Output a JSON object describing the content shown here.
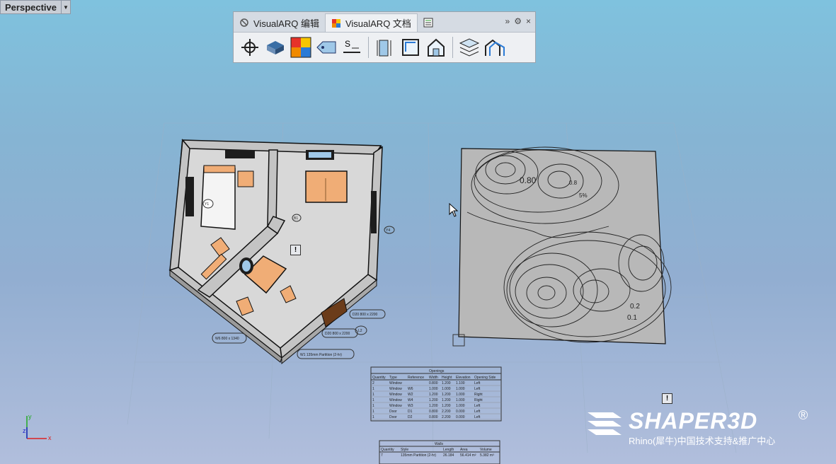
{
  "viewport": {
    "label": "Perspective"
  },
  "toolbar": {
    "tabs": [
      {
        "label": "VisualARQ 编辑",
        "icon": "visualarq-icon"
      },
      {
        "label": "VisualARQ 文档",
        "icon": "color-grid-icon"
      }
    ],
    "overflow": "»",
    "close": "×",
    "tools": [
      "origin-icon",
      "block-icon",
      "color-grid-icon",
      "tag-icon",
      "section-icon",
      "door-measure-icon",
      "window-icon",
      "house-icon",
      "layers-icon",
      "roof-icon"
    ]
  },
  "plan_labels": {
    "y1": "Y1",
    "y4": "Y4",
    "b1": "B1",
    "w6": "W6 800 x 1340",
    "d20": "D20 800 x 2200",
    "d20b": "D20 800 x 2200",
    "w1": "W1 135mm Partition (2-hr)",
    "l2": "L2"
  },
  "terrain_labels": {
    "a": "0.80",
    "b": "0.8",
    "c": "5%",
    "d": "0.2",
    "e": "0.1"
  },
  "openings_table": {
    "title": "Openings",
    "headers": [
      "Quantity",
      "Type",
      "Reference",
      "Width",
      "Height",
      "Elevation",
      "Opening Side"
    ],
    "rows": [
      [
        "2",
        "Window",
        "",
        "0.800",
        "1.200",
        "1.100",
        "Left"
      ],
      [
        "1",
        "Window",
        "W6",
        "1.000",
        "1.000",
        "1.000",
        "Left"
      ],
      [
        "1",
        "Window",
        "W2",
        "1.200",
        "1.200",
        "1.000",
        "Right"
      ],
      [
        "1",
        "Window",
        "W4",
        "1.200",
        "1.200",
        "1.000",
        "Right"
      ],
      [
        "1",
        "Window",
        "W3",
        "1.200",
        "1.200",
        "1.000",
        "Left"
      ],
      [
        "1",
        "Door",
        "D1",
        "0.800",
        "2.200",
        "0.000",
        "Left"
      ],
      [
        "1",
        "Door",
        "D2",
        "0.800",
        "2.200",
        "0.000",
        "Left"
      ]
    ]
  },
  "walls_table": {
    "title": "Walls",
    "headers": [
      "Quantity",
      "Style",
      "Length",
      "Area",
      "Volume"
    ],
    "rows": [
      [
        "7",
        "135mm Partition (2-hr)",
        "26.184",
        "56.414 m²",
        "5.382 m³"
      ]
    ]
  },
  "watermark": {
    "name": "SHAPER3D",
    "reg": "®",
    "sub": "Rhino(犀牛)中国技术支持&推广中心"
  },
  "axes": {
    "x": "x",
    "y": "y",
    "z": "z"
  },
  "colors": {
    "sky_top": "#7fc2de",
    "sky_bottom": "#b1bedc",
    "wall": "#c4c4c4",
    "furniture": "#f0ad76",
    "terrain": "#b8b8b8"
  }
}
